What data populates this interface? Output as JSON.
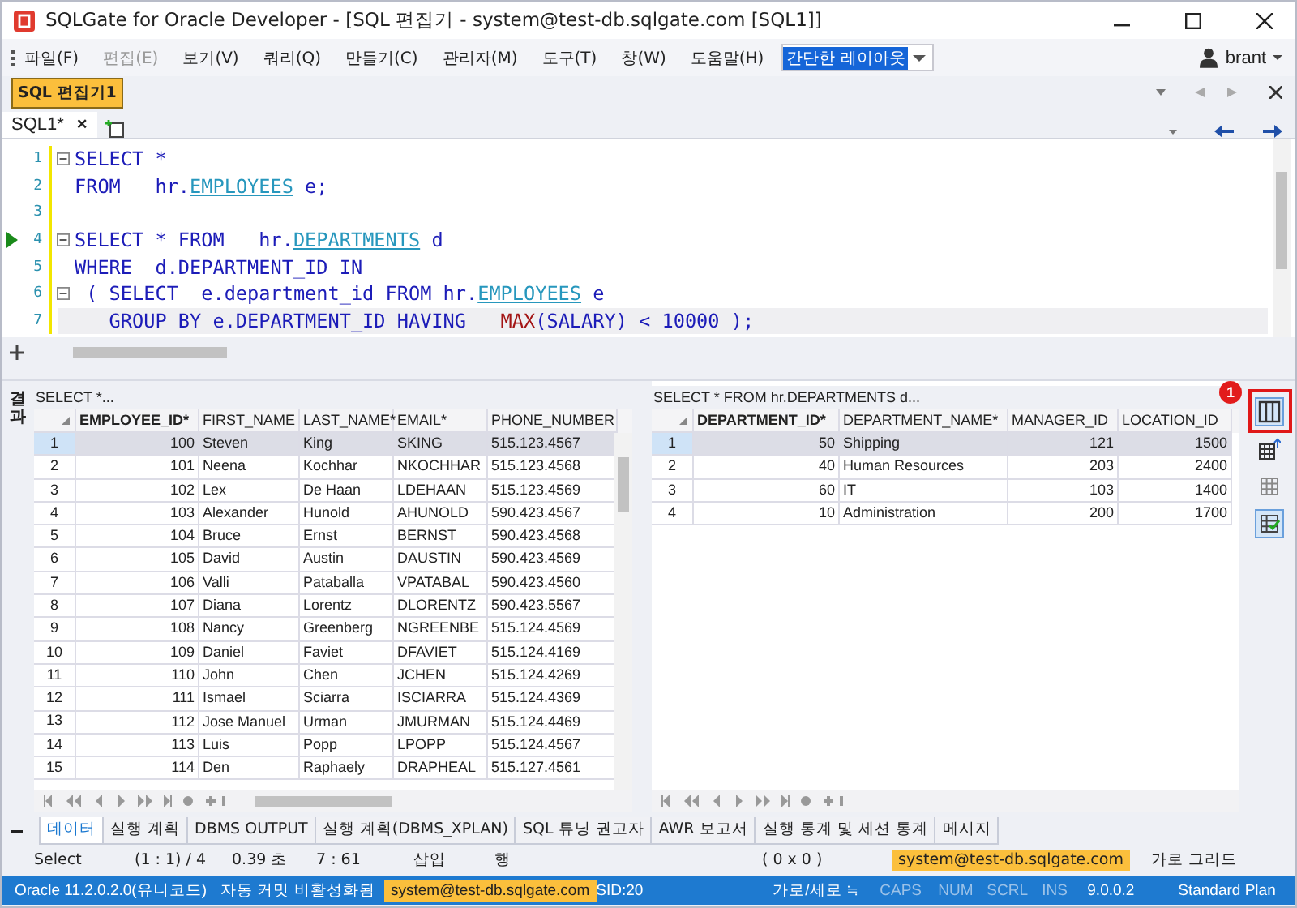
{
  "window": {
    "title": "SQLGate for Oracle Developer - [SQL 편집기 - system@test-db.sqlgate.com [SQL1]]"
  },
  "menu": [
    {
      "label": "파일(F)",
      "disabled": false
    },
    {
      "label": "편집(E)",
      "disabled": true
    },
    {
      "label": "보기(V)",
      "disabled": false
    },
    {
      "label": "쿼리(Q)",
      "disabled": false
    },
    {
      "label": "만들기(C)",
      "disabled": false
    },
    {
      "label": "관리자(M)",
      "disabled": false
    },
    {
      "label": "도구(T)",
      "disabled": false
    },
    {
      "label": "창(W)",
      "disabled": false
    },
    {
      "label": "도움말(H)",
      "disabled": false
    }
  ],
  "layout_combo": {
    "value": "간단한 레이아웃"
  },
  "user": "brant",
  "document_tab": "SQL 편집기1",
  "editor_tab": {
    "label": "SQL1*",
    "close": "×"
  },
  "code": [
    {
      "num": "1",
      "fold": true,
      "active": false,
      "executing": false,
      "segments": [
        {
          "kind": "kw",
          "text": "SELECT *"
        }
      ]
    },
    {
      "num": "2",
      "fold": false,
      "active": false,
      "executing": false,
      "segments": [
        {
          "kind": "kw",
          "text": "FROM   hr."
        },
        {
          "kind": "table",
          "text": "EMPLOYEES"
        },
        {
          "kind": "kw",
          "text": " e;"
        }
      ]
    },
    {
      "num": "3",
      "fold": false,
      "active": false,
      "executing": false
    },
    {
      "num": "4",
      "fold": true,
      "active": false,
      "executing": true,
      "segments": [
        {
          "kind": "kw",
          "text": "SELECT * FROM   hr."
        },
        {
          "kind": "table",
          "text": "DEPARTMENTS"
        },
        {
          "kind": "kw",
          "text": " d"
        }
      ]
    },
    {
      "num": "5",
      "fold": false,
      "active": false,
      "executing": false,
      "segments": [
        {
          "kind": "kw",
          "text": "WHERE  d.DEPARTMENT_ID IN"
        }
      ]
    },
    {
      "num": "6",
      "fold": true,
      "active": false,
      "executing": false,
      "segments": [
        {
          "kind": "kw",
          "text": " ( SELECT  e.department_id FROM hr."
        },
        {
          "kind": "table",
          "text": "EMPLOYEES"
        },
        {
          "kind": "kw",
          "text": " e"
        }
      ]
    },
    {
      "num": "7",
      "fold": false,
      "active": true,
      "executing": false,
      "segments": [
        {
          "kind": "kw",
          "text": "   GROUP BY e.DEPARTMENT_ID HAVING   "
        },
        {
          "kind": "func",
          "text": "MAX"
        },
        {
          "kind": "kw",
          "text": "(SALARY) < 10000 );"
        }
      ]
    }
  ],
  "result_label": "결과",
  "grids": [
    {
      "query": "SELECT *...",
      "columns": [
        {
          "label": "EMPLOYEE_ID*",
          "key": true,
          "numeric": true
        },
        {
          "label": "FIRST_NAME",
          "key": false,
          "numeric": false
        },
        {
          "label": "LAST_NAME*",
          "key": false,
          "numeric": false
        },
        {
          "label": "EMAIL*",
          "key": false,
          "numeric": false
        },
        {
          "label": "PHONE_NUMBER",
          "key": false,
          "numeric": false
        }
      ],
      "rows": [
        {
          "num": "1",
          "selected": true,
          "cells": [
            "100",
            "Steven",
            "King",
            "SKING",
            "515.123.4567"
          ]
        },
        {
          "num": "2",
          "selected": false,
          "cells": [
            "101",
            "Neena",
            "Kochhar",
            "NKOCHHAR",
            "515.123.4568"
          ]
        },
        {
          "num": "3",
          "selected": false,
          "cells": [
            "102",
            "Lex",
            "De Haan",
            "LDEHAAN",
            "515.123.4569"
          ]
        },
        {
          "num": "4",
          "selected": false,
          "cells": [
            "103",
            "Alexander",
            "Hunold",
            "AHUNOLD",
            "590.423.4567"
          ]
        },
        {
          "num": "5",
          "selected": false,
          "cells": [
            "104",
            "Bruce",
            "Ernst",
            "BERNST",
            "590.423.4568"
          ]
        },
        {
          "num": "6",
          "selected": false,
          "cells": [
            "105",
            "David",
            "Austin",
            "DAUSTIN",
            "590.423.4569"
          ]
        },
        {
          "num": "7",
          "selected": false,
          "cells": [
            "106",
            "Valli",
            "Pataballa",
            "VPATABAL",
            "590.423.4560"
          ]
        },
        {
          "num": "8",
          "selected": false,
          "cells": [
            "107",
            "Diana",
            "Lorentz",
            "DLORENTZ",
            "590.423.5567"
          ]
        },
        {
          "num": "9",
          "selected": false,
          "cells": [
            "108",
            "Nancy",
            "Greenberg",
            "NGREENBE",
            "515.124.4569"
          ]
        },
        {
          "num": "10",
          "selected": false,
          "cells": [
            "109",
            "Daniel",
            "Faviet",
            "DFAVIET",
            "515.124.4169"
          ]
        },
        {
          "num": "11",
          "selected": false,
          "cells": [
            "110",
            "John",
            "Chen",
            "JCHEN",
            "515.124.4269"
          ]
        },
        {
          "num": "12",
          "selected": false,
          "cells": [
            "111",
            "Ismael",
            "Sciarra",
            "ISCIARRA",
            "515.124.4369"
          ]
        },
        {
          "num": "13",
          "selected": false,
          "cells": [
            "112",
            "Jose Manuel",
            "Urman",
            "JMURMAN",
            "515.124.4469"
          ]
        },
        {
          "num": "14",
          "selected": false,
          "cells": [
            "113",
            "Luis",
            "Popp",
            "LPOPP",
            "515.124.4567"
          ]
        },
        {
          "num": "15",
          "selected": false,
          "cells": [
            "114",
            "Den",
            "Raphaely",
            "DRAPHEAL",
            "515.127.4561"
          ]
        }
      ]
    },
    {
      "query": "SELECT * FROM   hr.DEPARTMENTS d...",
      "columns": [
        {
          "label": "DEPARTMENT_ID*",
          "key": true,
          "numeric": true
        },
        {
          "label": "DEPARTMENT_NAME*",
          "key": false,
          "numeric": false
        },
        {
          "label": "MANAGER_ID",
          "key": false,
          "numeric": true
        },
        {
          "label": "LOCATION_ID",
          "key": false,
          "numeric": true
        }
      ],
      "rows": [
        {
          "num": "1",
          "selected": true,
          "cells": [
            "50",
            "Shipping",
            "121",
            "1500"
          ]
        },
        {
          "num": "2",
          "selected": false,
          "cells": [
            "40",
            "Human Resources",
            "203",
            "2400"
          ]
        },
        {
          "num": "3",
          "selected": false,
          "cells": [
            "60",
            "IT",
            "103",
            "1400"
          ]
        },
        {
          "num": "4",
          "selected": false,
          "cells": [
            "10",
            "Administration",
            "200",
            "1700"
          ]
        }
      ]
    }
  ],
  "side_tools": [
    {
      "kind": "columns",
      "selected": true
    },
    {
      "kind": "export",
      "selected": false
    },
    {
      "kind": "grid",
      "selected": false
    },
    {
      "kind": "check",
      "selected": true
    }
  ],
  "callout": "1",
  "result_tabs": [
    {
      "label": "데이터",
      "selected": true
    },
    {
      "label": "실행 계획",
      "selected": false
    },
    {
      "label": "DBMS OUTPUT",
      "selected": false
    },
    {
      "label": "실행 계획(DBMS_XPLAN)",
      "selected": false
    },
    {
      "label": "SQL 튜닝 권고자",
      "selected": false
    },
    {
      "label": "AWR 보고서",
      "selected": false
    },
    {
      "label": "실행 통계 및 세션 통계",
      "selected": false
    },
    {
      "label": "메시지",
      "selected": false
    }
  ],
  "info_bar": [
    {
      "text": "Select",
      "kind": "normal"
    },
    {
      "text": "(1 : 1) / 4",
      "kind": "normal"
    },
    {
      "text": "0.39 초",
      "kind": "normal"
    },
    {
      "text": "7 : 61",
      "kind": "normal"
    },
    {
      "text": "삽입",
      "kind": "normal"
    },
    {
      "text": "행",
      "kind": "normal"
    },
    {
      "text": "( 0 x 0 )",
      "kind": "normal"
    },
    {
      "text": "system@test-db.sqlgate.com",
      "kind": "highlight"
    },
    {
      "text": "가로 그리드",
      "kind": "normal"
    }
  ],
  "status_bar": [
    {
      "text": "Oracle 11.2.0.2.0(유니코드)",
      "kind": "normal"
    },
    {
      "text": "자동 커밋 비활성화됨",
      "kind": "normal"
    },
    {
      "text": "system@test-db.sqlgate.com",
      "kind": "highlight"
    },
    {
      "text": "SID:20",
      "kind": "normal"
    },
    {
      "text": "가로/세로 ≒",
      "kind": "normal"
    },
    {
      "text": "CAPS",
      "kind": "disabled"
    },
    {
      "text": "NUM",
      "kind": "disabled"
    },
    {
      "text": "SCRL",
      "kind": "disabled"
    },
    {
      "text": "INS",
      "kind": "disabled"
    },
    {
      "text": "9.0.0.2",
      "kind": "normal"
    },
    {
      "text": "Standard Plan",
      "kind": "normal"
    }
  ]
}
